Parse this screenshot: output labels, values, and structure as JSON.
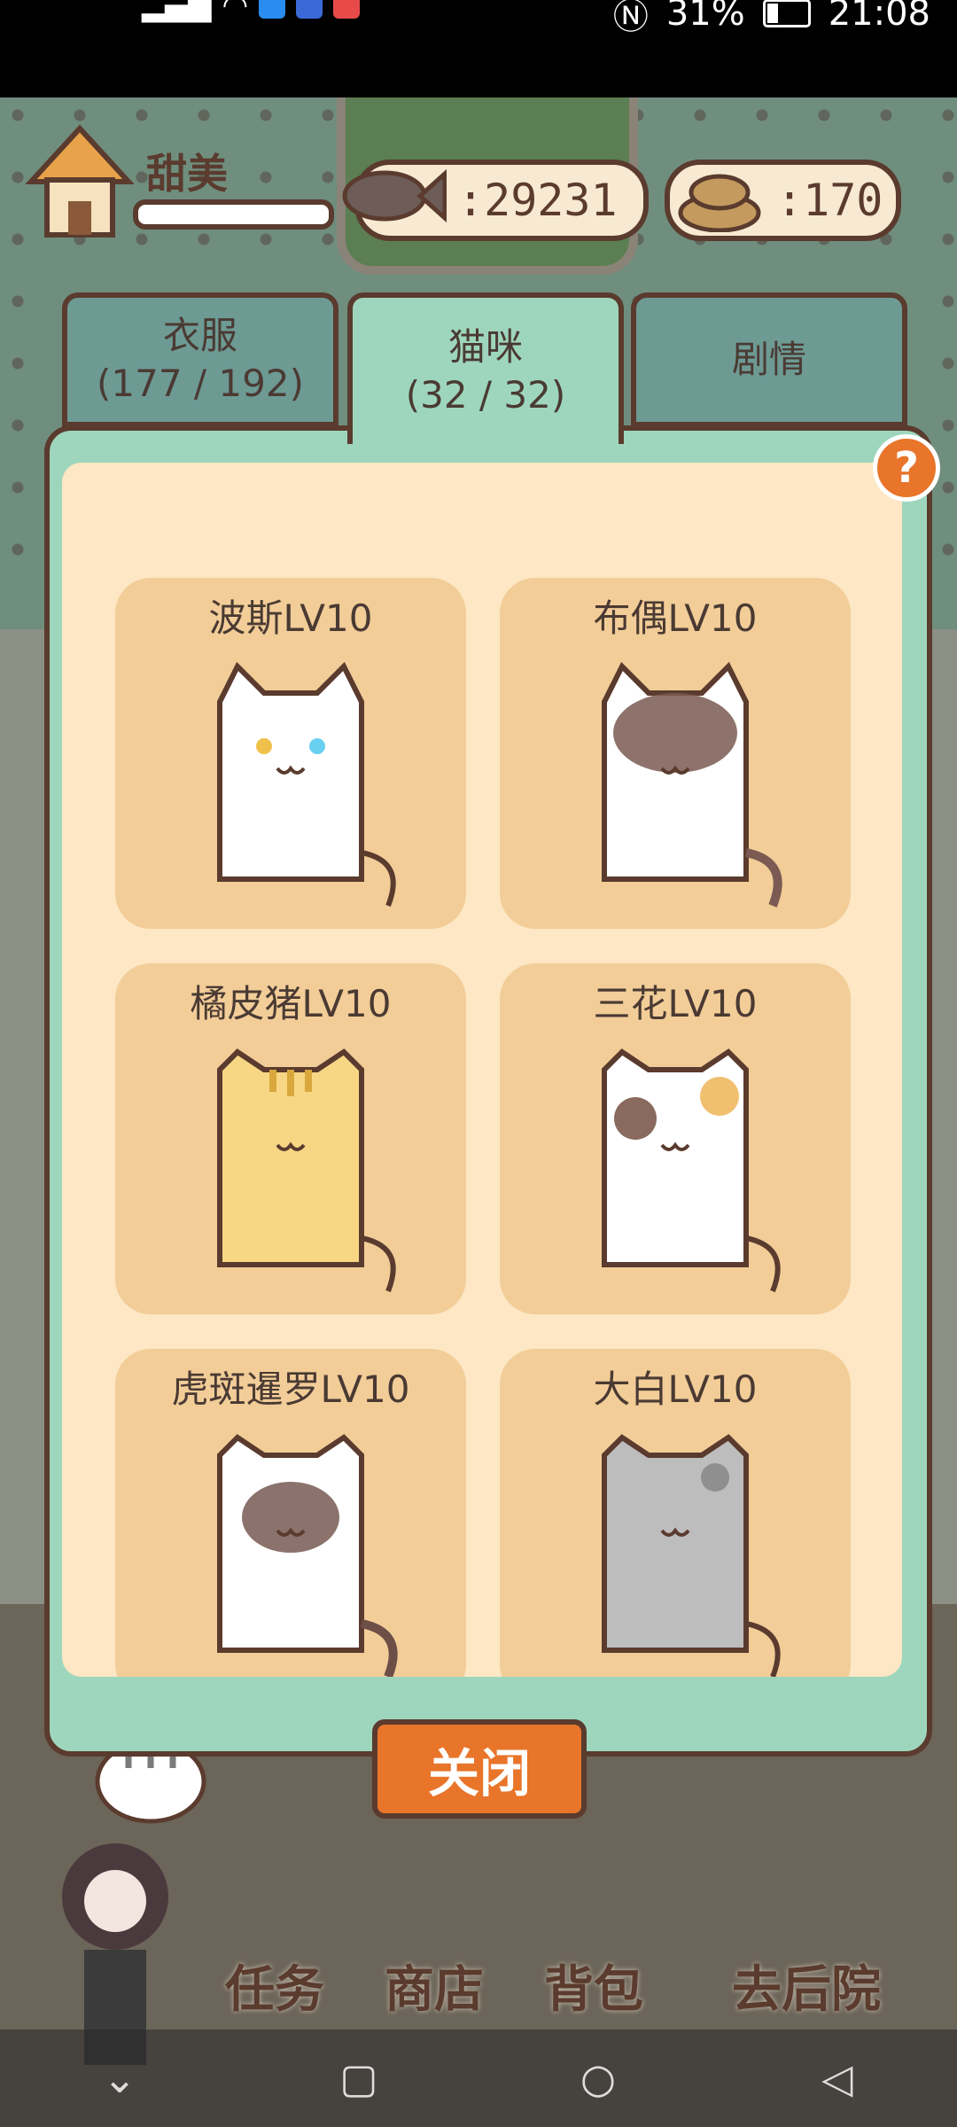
{
  "status_bar": {
    "right_status": "31%",
    "time": "21:08"
  },
  "header": {
    "player_name": "甜美",
    "fish_count": ":29231",
    "poop_count": ":170"
  },
  "tabs": [
    {
      "label": "衣服",
      "count": "(177 / 192)"
    },
    {
      "label": "猫咪",
      "count": "(32 / 32)"
    },
    {
      "label": "剧情",
      "count": ""
    }
  ],
  "cats": [
    {
      "name": "波斯LV10",
      "body": "#ffffff",
      "accent": "#ffffff"
    },
    {
      "name": "布偶LV10",
      "body": "#ffffff",
      "accent": "#7a5a52"
    },
    {
      "name": "橘皮猪LV10",
      "body": "#f7d784",
      "accent": "#d9a83c"
    },
    {
      "name": "三花LV10",
      "body": "#ffffff",
      "accent": "#8a6a5e"
    },
    {
      "name": "虎斑暹罗LV10",
      "body": "#ffffff",
      "accent": "#6e4f47"
    },
    {
      "name": "大白LV10",
      "body": "#bdbdbd",
      "accent": "#8f8f8f"
    }
  ],
  "close_label": "关闭",
  "bottom_nav": {
    "tasks": "任务",
    "shop": "商店",
    "bag": "背包",
    "backyard": "去后院"
  }
}
